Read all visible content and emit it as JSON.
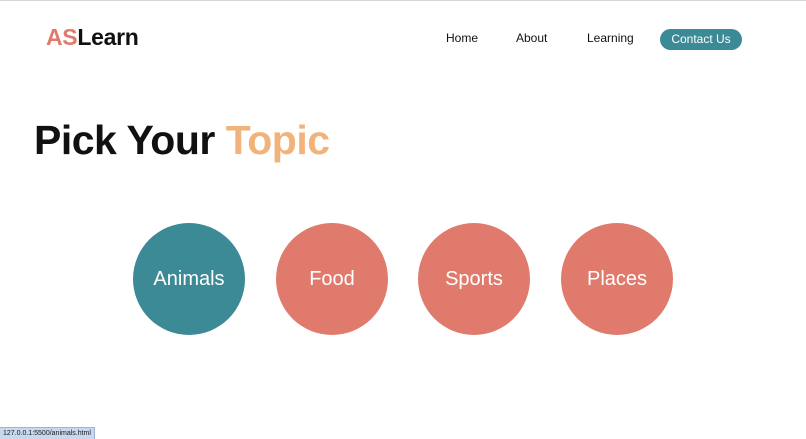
{
  "header": {
    "logo": {
      "accent": "AS",
      "rest": "Learn"
    },
    "nav": {
      "home": "Home",
      "about": "About",
      "learning": "Learning",
      "contact": "Contact Us"
    }
  },
  "main": {
    "title": {
      "prefix": "Pick Your ",
      "accent": "Topic"
    },
    "topics": [
      {
        "label": "Animals",
        "color": "#3c8a96"
      },
      {
        "label": "Food",
        "color": "#e07a6d"
      },
      {
        "label": "Sports",
        "color": "#e07a6d"
      },
      {
        "label": "Places",
        "color": "#e07a6d"
      }
    ]
  },
  "status_bar": {
    "url": "127.0.0.1:5500/animals.html"
  },
  "colors": {
    "brand_coral": "#e07a6d",
    "brand_teal": "#3c8a96",
    "title_accent": "#f2b37a"
  }
}
